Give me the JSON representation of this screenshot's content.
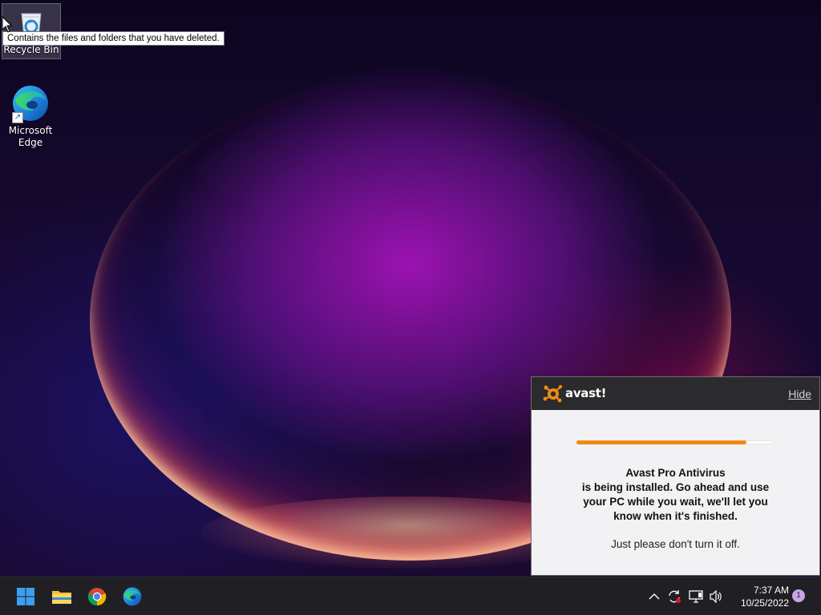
{
  "desktop": {
    "icons": [
      {
        "label": "Recycle Bin",
        "icon": "recycle-bin-icon"
      },
      {
        "label": "Microsoft Edge",
        "icon": "edge-icon"
      }
    ],
    "tooltip": "Contains the files and folders that you have deleted."
  },
  "avast": {
    "brand": "avast!",
    "hide_label": "Hide",
    "progress": 0.86,
    "accent": "#f08a12",
    "message_lines": [
      "Avast Pro Antivirus",
      "is being installed. Go ahead and use",
      "your PC while you wait, we'll let you",
      "know when it's finished."
    ],
    "note": "Just please don't turn it off."
  },
  "taskbar": {
    "apps": [
      {
        "name": "Start",
        "icon": "windows-start-icon"
      },
      {
        "name": "File Explorer",
        "icon": "folder-icon"
      },
      {
        "name": "Google Chrome",
        "icon": "chrome-icon"
      },
      {
        "name": "Microsoft Edge",
        "icon": "edge-icon"
      }
    ],
    "tray_icons": [
      "chevron-up-icon",
      "sync-icon",
      "network-icon",
      "volume-icon"
    ],
    "time": "7:37 AM",
    "date": "10/25/2022",
    "notification_count": "1"
  }
}
